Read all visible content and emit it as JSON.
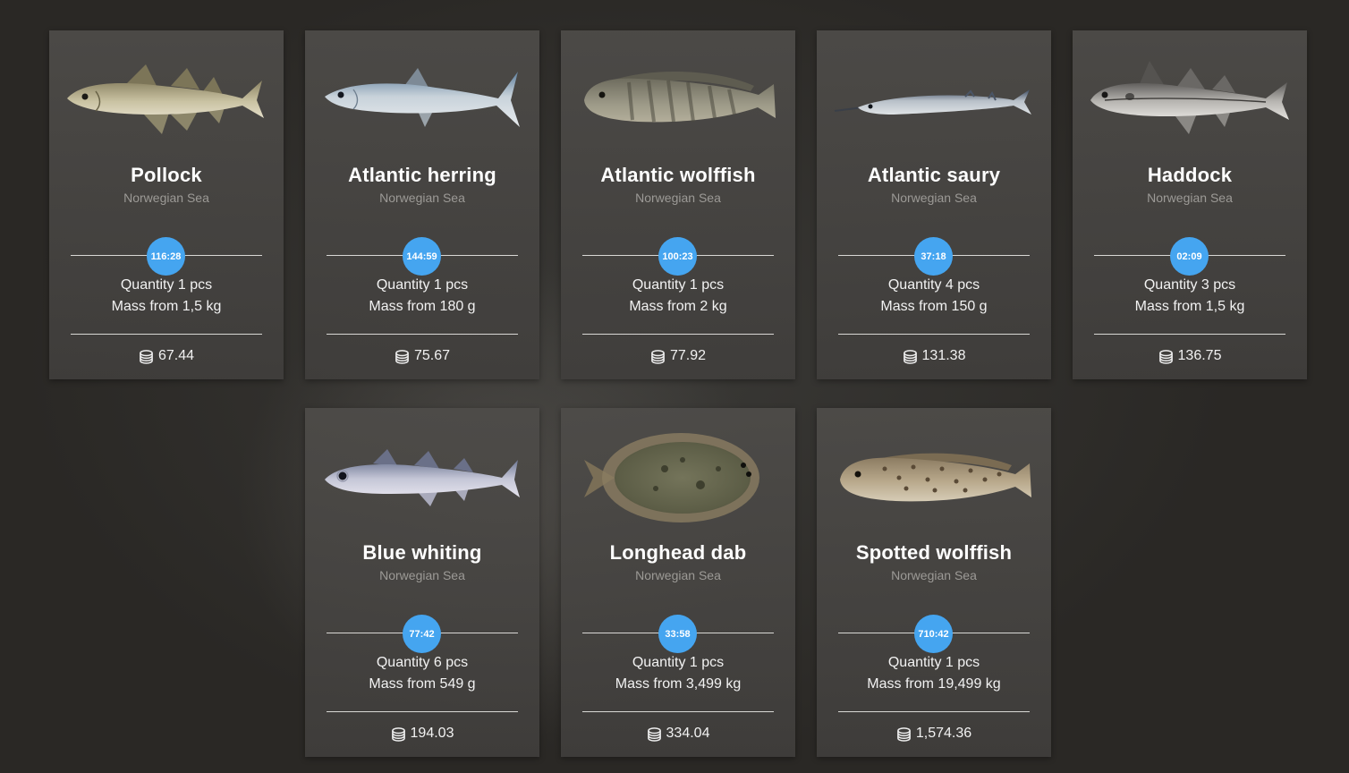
{
  "colors": {
    "timer_badge": "#45a5f0",
    "card_bg": "#4b4947",
    "subtle_text": "#9c9a96"
  },
  "cards": [
    {
      "name": "Pollock",
      "location": "Norwegian Sea",
      "timer": "116:28",
      "quantity": "Quantity 1 pcs",
      "mass": "Mass from 1,5 kg",
      "price": "67.44",
      "icon": "pollock-fish-icon"
    },
    {
      "name": "Atlantic herring",
      "location": "Norwegian Sea",
      "timer": "144:59",
      "quantity": "Quantity 1 pcs",
      "mass": "Mass from 180 g",
      "price": "75.67",
      "icon": "herring-fish-icon"
    },
    {
      "name": "Atlantic wolffish",
      "location": "Norwegian Sea",
      "timer": "100:23",
      "quantity": "Quantity 1 pcs",
      "mass": "Mass from 2 kg",
      "price": "77.92",
      "icon": "wolffish-fish-icon"
    },
    {
      "name": "Atlantic saury",
      "location": "Norwegian Sea",
      "timer": "37:18",
      "quantity": "Quantity 4 pcs",
      "mass": "Mass from 150 g",
      "price": "131.38",
      "icon": "saury-fish-icon"
    },
    {
      "name": "Haddock",
      "location": "Norwegian Sea",
      "timer": "02:09",
      "quantity": "Quantity 3 pcs",
      "mass": "Mass from 1,5 kg",
      "price": "136.75",
      "icon": "haddock-fish-icon"
    },
    {
      "name": "Blue whiting",
      "location": "Norwegian Sea",
      "timer": "77:42",
      "quantity": "Quantity 6 pcs",
      "mass": "Mass from 549 g",
      "price": "194.03",
      "icon": "blue-whiting-fish-icon"
    },
    {
      "name": "Longhead dab",
      "location": "Norwegian Sea",
      "timer": "33:58",
      "quantity": "Quantity 1 pcs",
      "mass": "Mass from 3,499 kg",
      "price": "334.04",
      "icon": "dab-fish-icon"
    },
    {
      "name": "Spotted wolffish",
      "location": "Norwegian Sea",
      "timer": "710:42",
      "quantity": "Quantity 1 pcs",
      "mass": "Mass from 19,499 kg",
      "price": "1,574.36",
      "icon": "spotted-wolffish-fish-icon"
    }
  ]
}
